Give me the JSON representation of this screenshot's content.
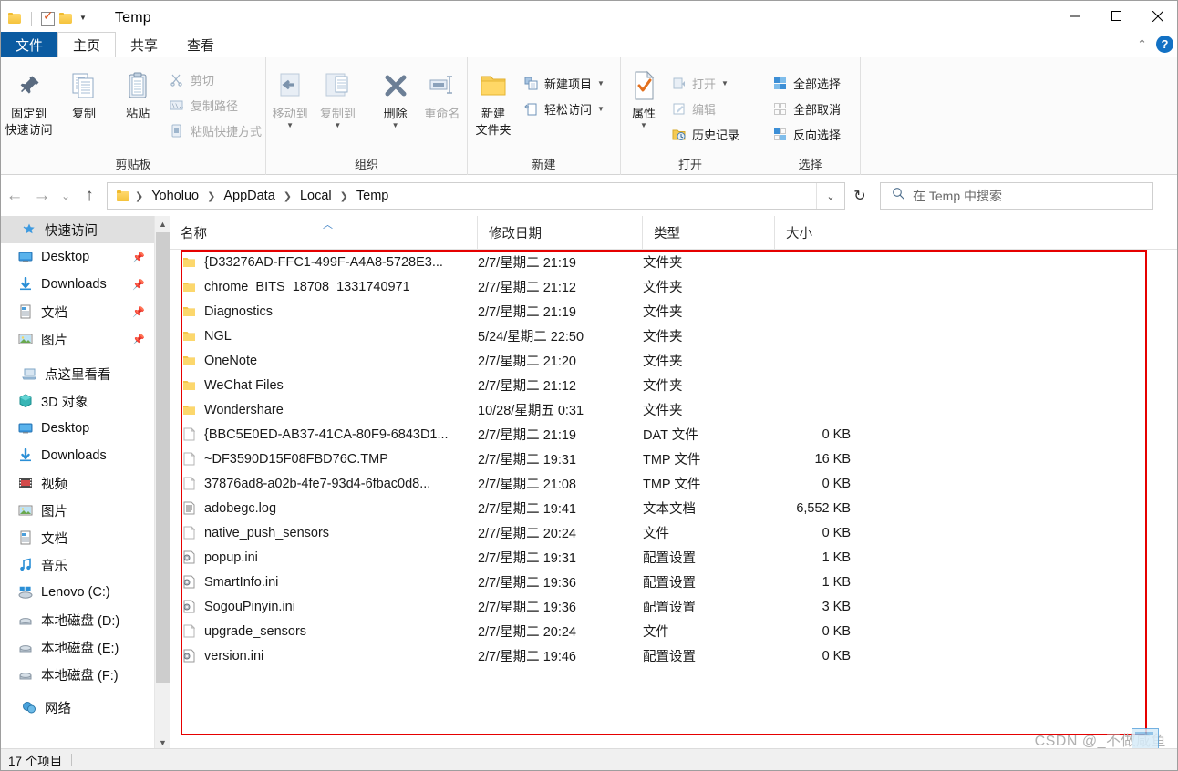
{
  "window": {
    "title": "Temp",
    "quick_access": [
      "folder-icon",
      "properties-check-icon",
      "new-folder-icon",
      "customize-caret"
    ],
    "minimize_label": "−",
    "maximize_label": "□",
    "close_label": "✕"
  },
  "tabs": [
    {
      "label": "文件",
      "kind": "file"
    },
    {
      "label": "主页",
      "kind": "active"
    },
    {
      "label": "共享",
      "kind": "normal"
    },
    {
      "label": "查看",
      "kind": "normal"
    }
  ],
  "tab_right": {
    "collapse": "⌃",
    "help": "?"
  },
  "ribbon": {
    "groups": [
      {
        "label": "剪贴板",
        "big": [
          {
            "label1": "固定到",
            "label2": "快速访问",
            "icon": "pin-icon",
            "disabled": false
          },
          {
            "label1": "复制",
            "label2": "",
            "icon": "copy-icon",
            "disabled": false
          },
          {
            "label1": "粘贴",
            "label2": "",
            "icon": "paste-icon",
            "disabled": false
          }
        ],
        "small": [
          {
            "label": "剪切",
            "icon": "cut-icon",
            "disabled": true
          },
          {
            "label": "复制路径",
            "icon": "copy-path-icon",
            "disabled": true
          },
          {
            "label": "粘贴快捷方式",
            "icon": "paste-shortcut-icon",
            "disabled": true
          }
        ]
      },
      {
        "label": "组织",
        "big": [
          {
            "label1": "移动到",
            "label2": "",
            "icon": "move-to-icon",
            "disabled": true,
            "caret": true
          },
          {
            "label1": "复制到",
            "label2": "",
            "icon": "copy-to-icon",
            "disabled": true,
            "caret": true
          },
          {
            "label1": "删除",
            "label2": "",
            "icon": "delete-icon",
            "disabled": false,
            "caret": true
          },
          {
            "label1": "重命名",
            "label2": "",
            "icon": "rename-icon",
            "disabled": true
          }
        ],
        "small": []
      },
      {
        "label": "新建",
        "big": [
          {
            "label1": "新建",
            "label2": "文件夹",
            "icon": "new-folder-icon",
            "disabled": false
          }
        ],
        "small": [
          {
            "label": "新建项目",
            "icon": "new-item-icon",
            "disabled": false,
            "caret": true
          },
          {
            "label": "轻松访问",
            "icon": "easy-access-icon",
            "disabled": false,
            "caret": true
          }
        ]
      },
      {
        "label": "打开",
        "big": [
          {
            "label1": "属性",
            "label2": "",
            "icon": "properties-icon",
            "disabled": false,
            "caret": true
          }
        ],
        "small": [
          {
            "label": "打开",
            "icon": "open-icon",
            "disabled": true,
            "caret": true
          },
          {
            "label": "编辑",
            "icon": "edit-icon",
            "disabled": true
          },
          {
            "label": "历史记录",
            "icon": "history-icon",
            "disabled": false
          }
        ]
      },
      {
        "label": "选择",
        "big": [],
        "small": [
          {
            "label": "全部选择",
            "icon": "select-all-icon",
            "disabled": false
          },
          {
            "label": "全部取消",
            "icon": "select-none-icon",
            "disabled": false
          },
          {
            "label": "反向选择",
            "icon": "invert-selection-icon",
            "disabled": false
          }
        ]
      }
    ]
  },
  "address": {
    "back": "←",
    "forward": "→",
    "recent": "⌄",
    "up": "↑",
    "breadcrumbs": [
      "Yoholuo",
      "AppData",
      "Local",
      "Temp"
    ],
    "dropdown": "⌄",
    "refresh": "↻"
  },
  "search": {
    "icon": "search-icon",
    "placeholder": "在 Temp 中搜索"
  },
  "nav": {
    "items": [
      {
        "label": "快速访问",
        "icon": "quick-access-star-icon",
        "level": 0,
        "selected": true,
        "pin": false
      },
      {
        "label": "Desktop",
        "icon": "desktop-icon",
        "level": 1,
        "selected": false,
        "pin": true
      },
      {
        "label": "Downloads",
        "icon": "downloads-icon",
        "level": 1,
        "selected": false,
        "pin": true
      },
      {
        "label": "文档",
        "icon": "documents-icon",
        "level": 1,
        "selected": false,
        "pin": true
      },
      {
        "label": "图片",
        "icon": "pictures-icon",
        "level": 1,
        "selected": false,
        "pin": true
      },
      {
        "label": "点这里看看",
        "icon": "this-pc-icon",
        "level": 0,
        "selected": false,
        "pin": false
      },
      {
        "label": "3D 对象",
        "icon": "3d-objects-icon",
        "level": 1,
        "selected": false,
        "pin": false
      },
      {
        "label": "Desktop",
        "icon": "desktop-icon",
        "level": 1,
        "selected": false,
        "pin": false
      },
      {
        "label": "Downloads",
        "icon": "downloads-icon",
        "level": 1,
        "selected": false,
        "pin": false
      },
      {
        "label": "视频",
        "icon": "videos-icon",
        "level": 1,
        "selected": false,
        "pin": false
      },
      {
        "label": "图片",
        "icon": "pictures-icon",
        "level": 1,
        "selected": false,
        "pin": false
      },
      {
        "label": "文档",
        "icon": "documents-icon",
        "level": 1,
        "selected": false,
        "pin": false
      },
      {
        "label": "音乐",
        "icon": "music-icon",
        "level": 1,
        "selected": false,
        "pin": false
      },
      {
        "label": "Lenovo (C:)",
        "icon": "windows-drive-icon",
        "level": 1,
        "selected": false,
        "pin": false
      },
      {
        "label": "本地磁盘 (D:)",
        "icon": "drive-icon",
        "level": 1,
        "selected": false,
        "pin": false
      },
      {
        "label": "本地磁盘 (E:)",
        "icon": "drive-icon",
        "level": 1,
        "selected": false,
        "pin": false
      },
      {
        "label": "本地磁盘 (F:)",
        "icon": "drive-icon",
        "level": 1,
        "selected": false,
        "pin": false
      },
      {
        "label": "网络",
        "icon": "network-icon",
        "level": 0,
        "selected": false,
        "pin": false
      }
    ]
  },
  "columns": [
    {
      "label": "名称",
      "key": "name"
    },
    {
      "label": "修改日期",
      "key": "date"
    },
    {
      "label": "类型",
      "key": "type"
    },
    {
      "label": "大小",
      "key": "size"
    }
  ],
  "files": [
    {
      "name": "{D33276AD-FFC1-499F-A4A8-5728E3...",
      "date": "2/7/星期二 21:19",
      "type": "文件夹",
      "size": "",
      "icon": "folder-icon"
    },
    {
      "name": "chrome_BITS_18708_1331740971",
      "date": "2/7/星期二 21:12",
      "type": "文件夹",
      "size": "",
      "icon": "folder-icon"
    },
    {
      "name": "Diagnostics",
      "date": "2/7/星期二 21:19",
      "type": "文件夹",
      "size": "",
      "icon": "folder-icon"
    },
    {
      "name": "NGL",
      "date": "5/24/星期二 22:50",
      "type": "文件夹",
      "size": "",
      "icon": "folder-icon"
    },
    {
      "name": "OneNote",
      "date": "2/7/星期二 21:20",
      "type": "文件夹",
      "size": "",
      "icon": "folder-icon"
    },
    {
      "name": "WeChat Files",
      "date": "2/7/星期二 21:12",
      "type": "文件夹",
      "size": "",
      "icon": "folder-icon"
    },
    {
      "name": "Wondershare",
      "date": "10/28/星期五 0:31",
      "type": "文件夹",
      "size": "",
      "icon": "folder-icon"
    },
    {
      "name": "{BBC5E0ED-AB37-41CA-80F9-6843D1...",
      "date": "2/7/星期二 21:19",
      "type": "DAT 文件",
      "size": "0 KB",
      "icon": "file-blank-icon"
    },
    {
      "name": "~DF3590D15F08FBD76C.TMP",
      "date": "2/7/星期二 19:31",
      "type": "TMP 文件",
      "size": "16 KB",
      "icon": "file-blank-icon"
    },
    {
      "name": "37876ad8-a02b-4fe7-93d4-6fbac0d8...",
      "date": "2/7/星期二 21:08",
      "type": "TMP 文件",
      "size": "0 KB",
      "icon": "file-blank-icon"
    },
    {
      "name": "adobegc.log",
      "date": "2/7/星期二 19:41",
      "type": "文本文档",
      "size": "6,552 KB",
      "icon": "text-file-icon"
    },
    {
      "name": "native_push_sensors",
      "date": "2/7/星期二 20:24",
      "type": "文件",
      "size": "0 KB",
      "icon": "file-blank-icon"
    },
    {
      "name": "popup.ini",
      "date": "2/7/星期二 19:31",
      "type": "配置设置",
      "size": "1 KB",
      "icon": "ini-file-icon"
    },
    {
      "name": "SmartInfo.ini",
      "date": "2/7/星期二 19:36",
      "type": "配置设置",
      "size": "1 KB",
      "icon": "ini-file-icon"
    },
    {
      "name": "SogouPinyin.ini",
      "date": "2/7/星期二 19:36",
      "type": "配置设置",
      "size": "3 KB",
      "icon": "ini-file-icon"
    },
    {
      "name": "upgrade_sensors",
      "date": "2/7/星期二 20:24",
      "type": "文件",
      "size": "0 KB",
      "icon": "file-blank-icon"
    },
    {
      "name": "version.ini",
      "date": "2/7/星期二 19:46",
      "type": "配置设置",
      "size": "0 KB",
      "icon": "ini-file-icon"
    }
  ],
  "status": {
    "item_count": "17 个项目"
  },
  "watermark": {
    "text": "CSDN @_不做咸鱼"
  },
  "colors": {
    "file_tab_blue": "#0b5ba1",
    "highlight_red": "#e60000",
    "folder_yellow": "#f5c33c",
    "accent_blue": "#1271c4"
  }
}
